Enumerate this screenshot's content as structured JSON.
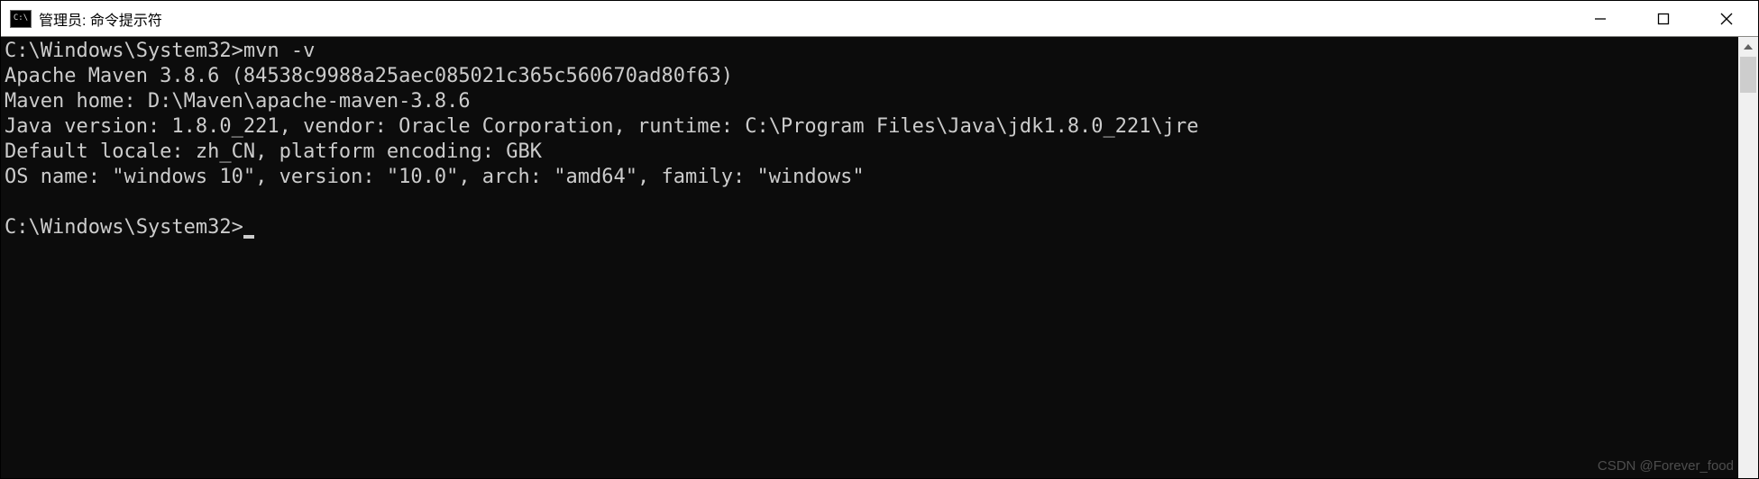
{
  "titlebar": {
    "title": "管理员: 命令提示符"
  },
  "terminal": {
    "prompt1": "C:\\Windows\\System32>",
    "command1": "mvn -v",
    "out_line1": "Apache Maven 3.8.6 (84538c9988a25aec085021c365c560670ad80f63)",
    "out_line2": "Maven home: D:\\Maven\\apache-maven-3.8.6",
    "out_line3": "Java version: 1.8.0_221, vendor: Oracle Corporation, runtime: C:\\Program Files\\Java\\jdk1.8.0_221\\jre",
    "out_line4": "Default locale: zh_CN, platform encoding: GBK",
    "out_line5": "OS name: \"windows 10\", version: \"10.0\", arch: \"amd64\", family: \"windows\"",
    "blank": "",
    "prompt2": "C:\\Windows\\System32>"
  },
  "watermark": "CSDN @Forever_food"
}
